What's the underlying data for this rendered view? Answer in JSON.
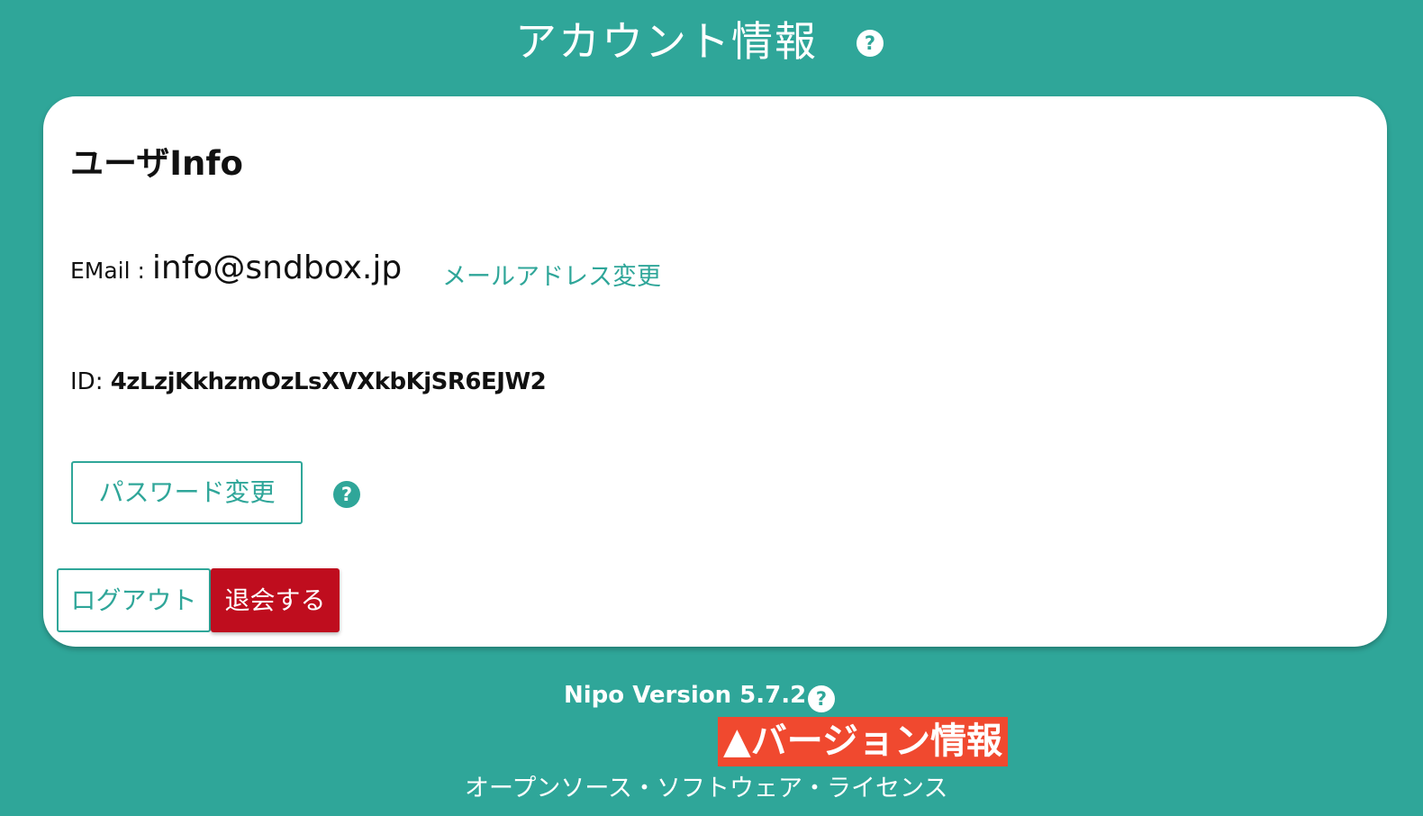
{
  "header": {
    "title": "アカウント情報",
    "help_icon": "?"
  },
  "card": {
    "title": "ユーザInfo",
    "email_label": "EMail : ",
    "email_value": "info@sndbox.jp",
    "email_change_link": "メールアドレス変更",
    "id_label": "ID: ",
    "id_value": "4zLzjKkhzmOzLsXVXkbKjSR6EJW2",
    "password_change_button": "パスワード変更",
    "password_help_icon": "?",
    "logout_button": "ログアウト",
    "withdraw_button": "退会する"
  },
  "footer": {
    "version": "Nipo Version 5.7.2",
    "version_help_icon": "?",
    "annotation": "▲バージョン情報",
    "license_link": "オープンソース・ソフトウェア・ライセンス"
  },
  "colors": {
    "background": "#2fa699",
    "accent": "#2fa699",
    "danger": "#bf0d1e",
    "annotation": "#f0492f"
  },
  "icons": {
    "help": "question-circle-icon"
  }
}
